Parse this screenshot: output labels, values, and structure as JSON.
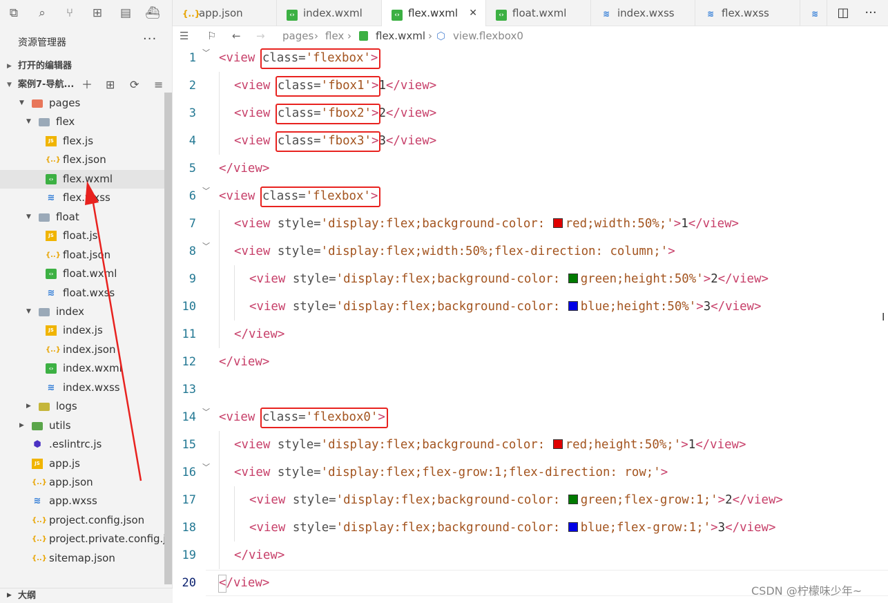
{
  "activity_icons": [
    "files-icon",
    "search-icon",
    "source-control-icon",
    "extensions-icon",
    "layout-icon",
    "docker-icon"
  ],
  "tabs": [
    {
      "label": "app.json",
      "icon": "json-file-icon",
      "active": false
    },
    {
      "label": "index.wxml",
      "icon": "wxml-file-icon",
      "active": false
    },
    {
      "label": "flex.wxml",
      "icon": "wxml-file-icon",
      "active": true,
      "close": "✕"
    },
    {
      "label": "float.wxml",
      "icon": "wxml-file-icon",
      "active": false
    },
    {
      "label": "index.wxss",
      "icon": "wxss-file-icon",
      "active": false
    },
    {
      "label": "flex.wxss",
      "icon": "wxss-file-icon",
      "active": false
    }
  ],
  "breadcrumb": {
    "part1": "pages",
    "part2": "flex",
    "file": "flex.wxml",
    "symbol": "view.flexbox0"
  },
  "sidebar": {
    "title": "资源管理器",
    "more": "···",
    "open_editors": "打开的编辑器",
    "project": "案例7-导航...",
    "outline": "大纲",
    "tree": [
      {
        "name": "pages",
        "kind": "folder-pages",
        "depth": 1,
        "expanded": true
      },
      {
        "name": "flex",
        "kind": "folder",
        "depth": 2,
        "expanded": true
      },
      {
        "name": "flex.js",
        "kind": "js",
        "depth": 3
      },
      {
        "name": "flex.json",
        "kind": "json",
        "depth": 3
      },
      {
        "name": "flex.wxml",
        "kind": "wxml",
        "depth": 3,
        "selected": true
      },
      {
        "name": "flex.wxss",
        "kind": "wxss",
        "depth": 3
      },
      {
        "name": "float",
        "kind": "folder",
        "depth": 2,
        "expanded": true
      },
      {
        "name": "float.js",
        "kind": "js",
        "depth": 3
      },
      {
        "name": "float.json",
        "kind": "json",
        "depth": 3
      },
      {
        "name": "float.wxml",
        "kind": "wxml",
        "depth": 3
      },
      {
        "name": "float.wxss",
        "kind": "wxss",
        "depth": 3
      },
      {
        "name": "index",
        "kind": "folder",
        "depth": 2,
        "expanded": true
      },
      {
        "name": "index.js",
        "kind": "js",
        "depth": 3
      },
      {
        "name": "index.json",
        "kind": "json",
        "depth": 3
      },
      {
        "name": "index.wxml",
        "kind": "wxml",
        "depth": 3
      },
      {
        "name": "index.wxss",
        "kind": "wxss",
        "depth": 3
      },
      {
        "name": "logs",
        "kind": "folder-logs",
        "depth": 2,
        "expanded": false
      },
      {
        "name": "utils",
        "kind": "folder-utils",
        "depth": 1,
        "expanded": false
      },
      {
        "name": ".eslintrc.js",
        "kind": "eslint",
        "depth": 1
      },
      {
        "name": "app.js",
        "kind": "js",
        "depth": 1
      },
      {
        "name": "app.json",
        "kind": "json",
        "depth": 1
      },
      {
        "name": "app.wxss",
        "kind": "wxss",
        "depth": 1
      },
      {
        "name": "project.config.json",
        "kind": "json",
        "depth": 1
      },
      {
        "name": "project.private.config.json",
        "kind": "json",
        "depth": 1
      },
      {
        "name": "sitemap.json",
        "kind": "json",
        "depth": 1
      }
    ]
  },
  "code_lines": [
    {
      "n": "1",
      "indent": 0,
      "fold": true,
      "tokens": [
        [
          "tag",
          "<view "
        ],
        [
          "attr",
          "class="
        ],
        [
          "str",
          "'flexbox'"
        ],
        [
          "tag",
          ">"
        ]
      ]
    },
    {
      "n": "2",
      "indent": 1,
      "tokens": [
        [
          "tag",
          "<view "
        ],
        [
          "attr",
          "class="
        ],
        [
          "str",
          "'fbox1'"
        ],
        [
          "tag",
          ">"
        ],
        [
          "num",
          "1"
        ],
        [
          "tag",
          "</view>"
        ]
      ]
    },
    {
      "n": "3",
      "indent": 1,
      "tokens": [
        [
          "tag",
          "<view "
        ],
        [
          "attr",
          "class="
        ],
        [
          "str",
          "'fbox2'"
        ],
        [
          "tag",
          ">"
        ],
        [
          "num",
          "2"
        ],
        [
          "tag",
          "</view>"
        ]
      ]
    },
    {
      "n": "4",
      "indent": 1,
      "tokens": [
        [
          "tag",
          "<view "
        ],
        [
          "attr",
          "class="
        ],
        [
          "str",
          "'fbox3'"
        ],
        [
          "tag",
          ">"
        ],
        [
          "num",
          "3"
        ],
        [
          "tag",
          "</view>"
        ]
      ]
    },
    {
      "n": "5",
      "indent": 0,
      "tokens": [
        [
          "tag",
          "</view>"
        ]
      ]
    },
    {
      "n": "6",
      "indent": 0,
      "fold": true,
      "tokens": [
        [
          "tag",
          "<view "
        ],
        [
          "attr",
          "class="
        ],
        [
          "str",
          "'flexbox'"
        ],
        [
          "tag",
          ">"
        ]
      ]
    },
    {
      "n": "7",
      "indent": 1,
      "tokens": [
        [
          "tag",
          "<view "
        ],
        [
          "attr",
          "style="
        ],
        [
          "str",
          "'display:flex;background-color: "
        ],
        [
          "swatch",
          "#e00000"
        ],
        [
          "str",
          "red;width:50%;'"
        ],
        [
          "tag",
          ">"
        ],
        [
          "num",
          "1"
        ],
        [
          "tag",
          "</view>"
        ]
      ]
    },
    {
      "n": "8",
      "indent": 1,
      "fold": true,
      "tokens": [
        [
          "tag",
          "<view "
        ],
        [
          "attr",
          "style="
        ],
        [
          "str",
          "'display:flex;width:50%;flex-direction: column;'"
        ],
        [
          "tag",
          ">"
        ]
      ]
    },
    {
      "n": "9",
      "indent": 2,
      "tokens": [
        [
          "tag",
          "<view "
        ],
        [
          "attr",
          "style="
        ],
        [
          "str",
          "'display:flex;background-color: "
        ],
        [
          "swatch",
          "#007a00"
        ],
        [
          "str",
          "green;height:50%'"
        ],
        [
          "tag",
          ">"
        ],
        [
          "num",
          "2"
        ],
        [
          "tag",
          "</view>"
        ]
      ]
    },
    {
      "n": "10",
      "indent": 2,
      "tokens": [
        [
          "tag",
          "<view "
        ],
        [
          "attr",
          "style="
        ],
        [
          "str",
          "'display:flex;background-color: "
        ],
        [
          "swatch",
          "#0000e6"
        ],
        [
          "str",
          "blue;height:50%'"
        ],
        [
          "tag",
          ">"
        ],
        [
          "num",
          "3"
        ],
        [
          "tag",
          "</view>"
        ]
      ]
    },
    {
      "n": "11",
      "indent": 1,
      "tokens": [
        [
          "tag",
          "</view>"
        ]
      ]
    },
    {
      "n": "12",
      "indent": 0,
      "tokens": [
        [
          "tag",
          "</view>"
        ]
      ]
    },
    {
      "n": "13",
      "indent": 0,
      "tokens": []
    },
    {
      "n": "14",
      "indent": 0,
      "fold": true,
      "tokens": [
        [
          "tag",
          "<view "
        ],
        [
          "attr",
          "class="
        ],
        [
          "str",
          "'flexbox0'"
        ],
        [
          "tag",
          ">"
        ]
      ]
    },
    {
      "n": "15",
      "indent": 1,
      "tokens": [
        [
          "tag",
          "<view "
        ],
        [
          "attr",
          "style="
        ],
        [
          "str",
          "'display:flex;background-color: "
        ],
        [
          "swatch",
          "#e00000"
        ],
        [
          "str",
          "red;height:50%;'"
        ],
        [
          "tag",
          ">"
        ],
        [
          "num",
          "1"
        ],
        [
          "tag",
          "</view>"
        ]
      ]
    },
    {
      "n": "16",
      "indent": 1,
      "fold": true,
      "tokens": [
        [
          "tag",
          "<view "
        ],
        [
          "attr",
          "style="
        ],
        [
          "str",
          "'display:flex;flex-grow:1;flex-direction: row;'"
        ],
        [
          "tag",
          ">"
        ]
      ]
    },
    {
      "n": "17",
      "indent": 2,
      "tokens": [
        [
          "tag",
          "<view "
        ],
        [
          "attr",
          "style="
        ],
        [
          "str",
          "'display:flex;background-color: "
        ],
        [
          "swatch",
          "#007a00"
        ],
        [
          "str",
          "green;flex-grow:1;'"
        ],
        [
          "tag",
          ">"
        ],
        [
          "num",
          "2"
        ],
        [
          "tag",
          "</view>"
        ]
      ]
    },
    {
      "n": "18",
      "indent": 2,
      "tokens": [
        [
          "tag",
          "<view "
        ],
        [
          "attr",
          "style="
        ],
        [
          "str",
          "'display:flex;background-color: "
        ],
        [
          "swatch",
          "#0000e6"
        ],
        [
          "str",
          "blue;flex-grow:1;'"
        ],
        [
          "tag",
          ">"
        ],
        [
          "num",
          "3"
        ],
        [
          "tag",
          "</view>"
        ]
      ]
    },
    {
      "n": "19",
      "indent": 1,
      "tokens": [
        [
          "tag",
          "</view>"
        ]
      ]
    },
    {
      "n": "20",
      "indent": 0,
      "current": true,
      "tokens": [
        [
          "tag",
          "</view>"
        ]
      ]
    }
  ],
  "watermark": "CSDN @柠檬味少年~",
  "colors": {
    "highlight": "#e8221f",
    "tag": "#c73f69",
    "string": "#a3541f",
    "line_number": "#237893"
  }
}
